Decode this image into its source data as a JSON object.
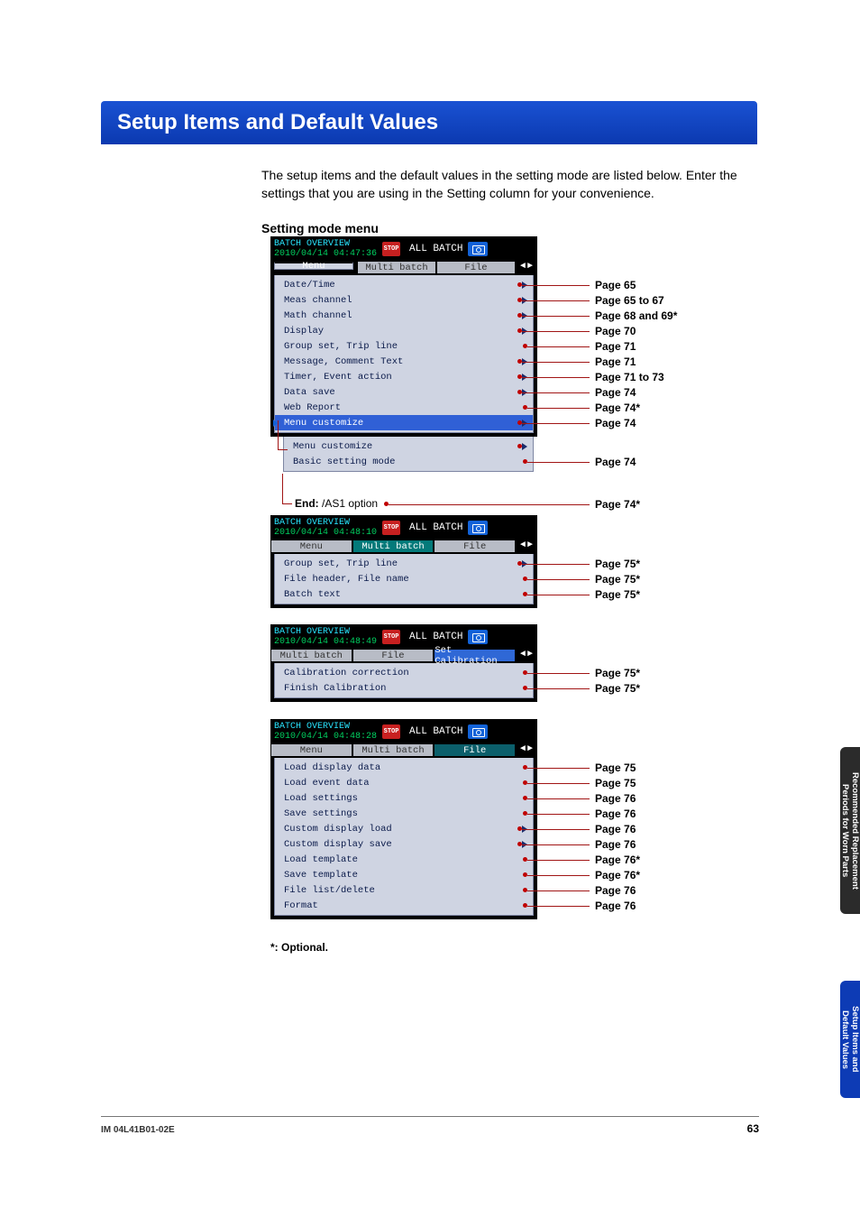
{
  "banner_title": "Setup Items and Default Values",
  "intro_text": "The setup items and the default values in the setting mode are listed below. Enter the settings that you are using in the Setting column for your convenience.",
  "section_header": "Setting mode menu",
  "optional_note": "*: Optional.",
  "end_label": "End: ",
  "end_option": "/AS1 option",
  "footer_code": "IM 04L41B01-02E",
  "page_number": "63",
  "side_tab_upper": "Recommended Replacement\nPeriods for Worn Parts",
  "side_tab_lower": "Setup Items and\nDefault Values",
  "panel_common": {
    "title_line": "BATCH OVERVIEW",
    "allbatch": "ALL BATCH",
    "stop": "STOP",
    "arrows_l": "◄",
    "arrows_r": "►"
  },
  "panels": {
    "p1": {
      "timestamp": "2010/04/14 04:47:36",
      "tabs": [
        "Menu",
        "Multi batch",
        "File"
      ],
      "active_tab": 0,
      "items": [
        {
          "label": "Date/Time",
          "tri": true,
          "page": "Page 65"
        },
        {
          "label": "Meas channel",
          "tri": true,
          "page": "Page 65 to 67"
        },
        {
          "label": "Math channel",
          "tri": true,
          "page": "Page 68 and 69*"
        },
        {
          "label": "Display",
          "tri": true,
          "page": "Page 70"
        },
        {
          "label": "Group set, Trip line",
          "tri": false,
          "page": "Page 71"
        },
        {
          "label": "Message, Comment Text",
          "tri": true,
          "page": "Page 71"
        },
        {
          "label": "Timer, Event action",
          "tri": true,
          "page": "Page 71 to 73"
        },
        {
          "label": "Data save",
          "tri": true,
          "page": "Page 74"
        },
        {
          "label": "Web Report",
          "tri": false,
          "page": "Page 74*"
        },
        {
          "label": "Menu customize",
          "tri": true,
          "sel": true,
          "page": "Page 74"
        }
      ]
    },
    "p1b": {
      "items": [
        {
          "label": "Menu customize",
          "tri": true
        },
        {
          "label": "Basic setting mode",
          "tri": false,
          "page": "Page 74"
        }
      ],
      "end_page": "Page 74*"
    },
    "p2": {
      "timestamp": "2010/04/14 04:48:10",
      "tabs": [
        "Menu",
        "Multi batch",
        "File"
      ],
      "active_tab": 1,
      "items": [
        {
          "label": "Group set, Trip line",
          "tri": true,
          "page": "Page 75*"
        },
        {
          "label": "File header, File name",
          "tri": false,
          "page": "Page 75*"
        },
        {
          "label": "Batch text",
          "tri": false,
          "page": "Page 75*"
        }
      ]
    },
    "p3": {
      "timestamp": "2010/04/14 04:48:49",
      "tabs": [
        "Multi batch",
        "File",
        "Set Calibration"
      ],
      "active_tab": 2,
      "items": [
        {
          "label": "Calibration correction",
          "tri": false,
          "page": "Page 75*"
        },
        {
          "label": "Finish Calibration",
          "tri": false,
          "page": "Page 75*"
        }
      ]
    },
    "p4": {
      "timestamp": "2010/04/14 04:48:28",
      "tabs": [
        "Menu",
        "Multi batch",
        "File"
      ],
      "active_tab": 2,
      "items": [
        {
          "label": "Load display data",
          "tri": false,
          "page": "Page 75"
        },
        {
          "label": "Load event data",
          "tri": false,
          "page": "Page 75"
        },
        {
          "label": "Load settings",
          "tri": false,
          "page": "Page 76"
        },
        {
          "label": "Save settings",
          "tri": false,
          "page": "Page 76"
        },
        {
          "label": "Custom display load",
          "tri": true,
          "page": "Page 76"
        },
        {
          "label": "Custom display save",
          "tri": true,
          "page": "Page 76"
        },
        {
          "label": "Load template",
          "tri": false,
          "page": "Page 76*"
        },
        {
          "label": "Save template",
          "tri": false,
          "page": "Page 76*"
        },
        {
          "label": "File list/delete",
          "tri": false,
          "page": "Page 76"
        },
        {
          "label": "Format",
          "tri": false,
          "page": "Page 76"
        }
      ]
    }
  }
}
